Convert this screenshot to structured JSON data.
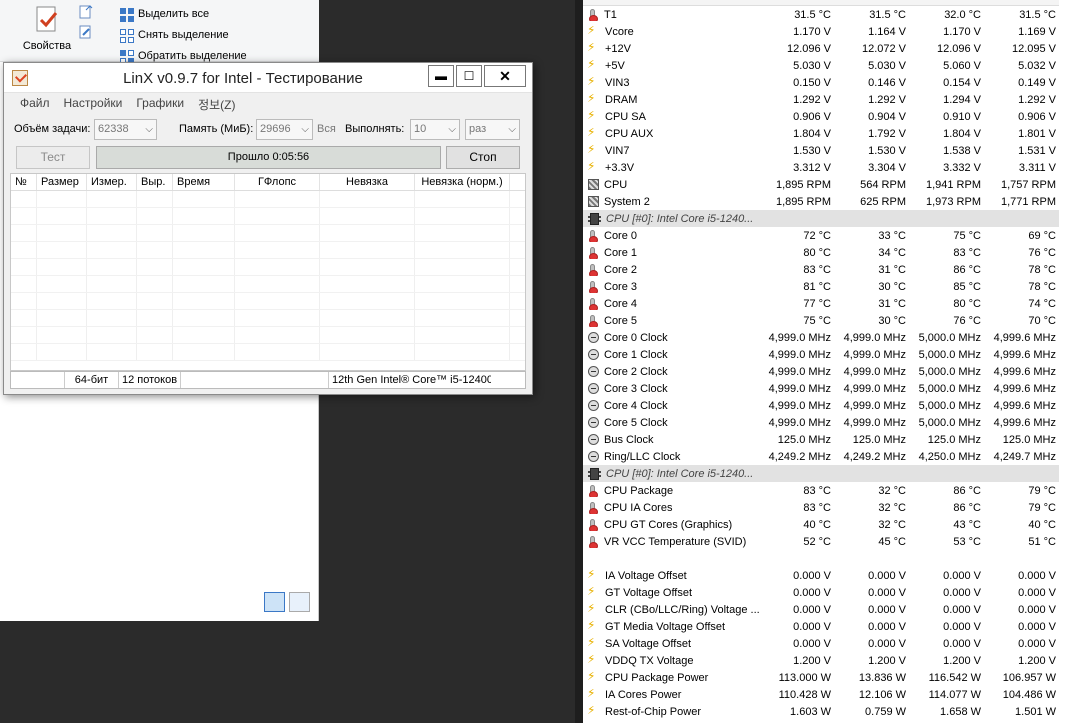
{
  "explorer": {
    "properties_label": "Свойства",
    "select_all": "Выделить все",
    "deselect": "Снять выделение",
    "invert": "Обратить выделение"
  },
  "linx": {
    "title": "LinX v0.9.7 for Intel - Тестирование",
    "menu": [
      "Файл",
      "Настройки",
      "Графики",
      "정보(Z)"
    ],
    "problem_size_label": "Объём задачи:",
    "problem_size_value": "62338",
    "memory_label": "Память (МиБ):",
    "memory_value": "29696",
    "memory_all": "Вся",
    "run_label": "Выполнять:",
    "run_value": "10",
    "run_unit": "раз",
    "test_button": "Тест",
    "elapsed": "Прошло 0:05:56",
    "stop_button": "Стоп",
    "columns": [
      "№",
      "Размер",
      "Измер.",
      "Выр.",
      "Время",
      "ГФлопс",
      "Невязка",
      "Невязка (норм.)"
    ],
    "status": [
      "64-бит",
      "12 потоков",
      "12th Gen Intel® Core™ i5-12400"
    ]
  },
  "hwinfo": {
    "rows": [
      {
        "type": "therm",
        "name": "T1",
        "cur": "31.5 °C",
        "min": "31.5 °C",
        "max": "32.0 °C",
        "avg": "31.5 °C"
      },
      {
        "type": "volt",
        "name": "Vcore",
        "cur": "1.170 V",
        "min": "1.164 V",
        "max": "1.170 V",
        "avg": "1.169 V"
      },
      {
        "type": "volt",
        "name": "+12V",
        "cur": "12.096 V",
        "min": "12.072 V",
        "max": "12.096 V",
        "avg": "12.095 V"
      },
      {
        "type": "volt",
        "name": "+5V",
        "cur": "5.030 V",
        "min": "5.030 V",
        "max": "5.060 V",
        "avg": "5.032 V"
      },
      {
        "type": "volt",
        "name": "VIN3",
        "cur": "0.150 V",
        "min": "0.146 V",
        "max": "0.154 V",
        "avg": "0.149 V"
      },
      {
        "type": "volt",
        "name": "DRAM",
        "cur": "1.292 V",
        "min": "1.292 V",
        "max": "1.294 V",
        "avg": "1.292 V"
      },
      {
        "type": "volt",
        "name": "CPU SA",
        "cur": "0.906 V",
        "min": "0.904 V",
        "max": "0.910 V",
        "avg": "0.906 V"
      },
      {
        "type": "volt",
        "name": "CPU AUX",
        "cur": "1.804 V",
        "min": "1.792 V",
        "max": "1.804 V",
        "avg": "1.801 V"
      },
      {
        "type": "volt",
        "name": "VIN7",
        "cur": "1.530 V",
        "min": "1.530 V",
        "max": "1.538 V",
        "avg": "1.531 V"
      },
      {
        "type": "volt",
        "name": "+3.3V",
        "cur": "3.312 V",
        "min": "3.304 V",
        "max": "3.332 V",
        "avg": "3.311 V"
      },
      {
        "type": "fan",
        "name": "CPU",
        "cur": "1,895 RPM",
        "min": "564 RPM",
        "max": "1,941 RPM",
        "avg": "1,757 RPM"
      },
      {
        "type": "fan",
        "name": "System 2",
        "cur": "1,895 RPM",
        "min": "625 RPM",
        "max": "1,973 RPM",
        "avg": "1,771 RPM"
      },
      {
        "type": "group",
        "name": "CPU [#0]: Intel Core i5-1240..."
      },
      {
        "type": "therm",
        "name": "Core 0",
        "cur": "72 °C",
        "min": "33 °C",
        "max": "75 °C",
        "avg": "69 °C"
      },
      {
        "type": "therm",
        "name": "Core 1",
        "cur": "80 °C",
        "min": "34 °C",
        "max": "83 °C",
        "avg": "76 °C"
      },
      {
        "type": "therm",
        "name": "Core 2",
        "cur": "83 °C",
        "min": "31 °C",
        "max": "86 °C",
        "avg": "78 °C"
      },
      {
        "type": "therm",
        "name": "Core 3",
        "cur": "81 °C",
        "min": "30 °C",
        "max": "85 °C",
        "avg": "78 °C"
      },
      {
        "type": "therm",
        "name": "Core 4",
        "cur": "77 °C",
        "min": "31 °C",
        "max": "80 °C",
        "avg": "74 °C"
      },
      {
        "type": "therm",
        "name": "Core 5",
        "cur": "75 °C",
        "min": "30 °C",
        "max": "76 °C",
        "avg": "70 °C"
      },
      {
        "type": "clock",
        "name": "Core 0 Clock",
        "cur": "4,999.0 MHz",
        "min": "4,999.0 MHz",
        "max": "5,000.0 MHz",
        "avg": "4,999.6 MHz"
      },
      {
        "type": "clock",
        "name": "Core 1 Clock",
        "cur": "4,999.0 MHz",
        "min": "4,999.0 MHz",
        "max": "5,000.0 MHz",
        "avg": "4,999.6 MHz"
      },
      {
        "type": "clock",
        "name": "Core 2 Clock",
        "cur": "4,999.0 MHz",
        "min": "4,999.0 MHz",
        "max": "5,000.0 MHz",
        "avg": "4,999.6 MHz"
      },
      {
        "type": "clock",
        "name": "Core 3 Clock",
        "cur": "4,999.0 MHz",
        "min": "4,999.0 MHz",
        "max": "5,000.0 MHz",
        "avg": "4,999.6 MHz"
      },
      {
        "type": "clock",
        "name": "Core 4 Clock",
        "cur": "4,999.0 MHz",
        "min": "4,999.0 MHz",
        "max": "5,000.0 MHz",
        "avg": "4,999.6 MHz"
      },
      {
        "type": "clock",
        "name": "Core 5 Clock",
        "cur": "4,999.0 MHz",
        "min": "4,999.0 MHz",
        "max": "5,000.0 MHz",
        "avg": "4,999.6 MHz"
      },
      {
        "type": "clock",
        "name": "Bus Clock",
        "cur": "125.0 MHz",
        "min": "125.0 MHz",
        "max": "125.0 MHz",
        "avg": "125.0 MHz"
      },
      {
        "type": "clock",
        "name": "Ring/LLC Clock",
        "cur": "4,249.2 MHz",
        "min": "4,249.2 MHz",
        "max": "4,250.0 MHz",
        "avg": "4,249.7 MHz"
      },
      {
        "type": "group",
        "name": "CPU [#0]: Intel Core i5-1240..."
      },
      {
        "type": "therm",
        "name": "CPU Package",
        "cur": "83 °C",
        "min": "32 °C",
        "max": "86 °C",
        "avg": "79 °C"
      },
      {
        "type": "therm",
        "name": "CPU IA Cores",
        "cur": "83 °C",
        "min": "32 °C",
        "max": "86 °C",
        "avg": "79 °C"
      },
      {
        "type": "therm",
        "name": "CPU GT Cores (Graphics)",
        "cur": "40 °C",
        "min": "32 °C",
        "max": "43 °C",
        "avg": "40 °C"
      },
      {
        "type": "therm",
        "name": "VR VCC Temperature (SVID)",
        "cur": "52 °C",
        "min": "45 °C",
        "max": "53 °C",
        "avg": "51 °C"
      },
      {
        "type": "blank",
        "name": ""
      },
      {
        "type": "volt",
        "name": "IA Voltage Offset",
        "cur": "0.000 V",
        "min": "0.000 V",
        "max": "0.000 V",
        "avg": "0.000 V"
      },
      {
        "type": "volt",
        "name": "GT Voltage Offset",
        "cur": "0.000 V",
        "min": "0.000 V",
        "max": "0.000 V",
        "avg": "0.000 V"
      },
      {
        "type": "volt",
        "name": "CLR (CBo/LLC/Ring) Voltage ...",
        "cur": "0.000 V",
        "min": "0.000 V",
        "max": "0.000 V",
        "avg": "0.000 V"
      },
      {
        "type": "volt",
        "name": "GT Media Voltage Offset",
        "cur": "0.000 V",
        "min": "0.000 V",
        "max": "0.000 V",
        "avg": "0.000 V"
      },
      {
        "type": "volt",
        "name": "SA Voltage Offset",
        "cur": "0.000 V",
        "min": "0.000 V",
        "max": "0.000 V",
        "avg": "0.000 V"
      },
      {
        "type": "volt",
        "name": "VDDQ TX Voltage",
        "cur": "1.200 V",
        "min": "1.200 V",
        "max": "1.200 V",
        "avg": "1.200 V"
      },
      {
        "type": "volt",
        "name": "CPU Package Power",
        "cur": "113.000 W",
        "min": "13.836 W",
        "max": "116.542 W",
        "avg": "106.957 W"
      },
      {
        "type": "volt",
        "name": "IA Cores Power",
        "cur": "110.428 W",
        "min": "12.106 W",
        "max": "114.077 W",
        "avg": "104.486 W"
      },
      {
        "type": "volt",
        "name": "Rest-of-Chip Power",
        "cur": "1.603 W",
        "min": "0.759 W",
        "max": "1.658 W",
        "avg": "1.501 W"
      }
    ]
  }
}
